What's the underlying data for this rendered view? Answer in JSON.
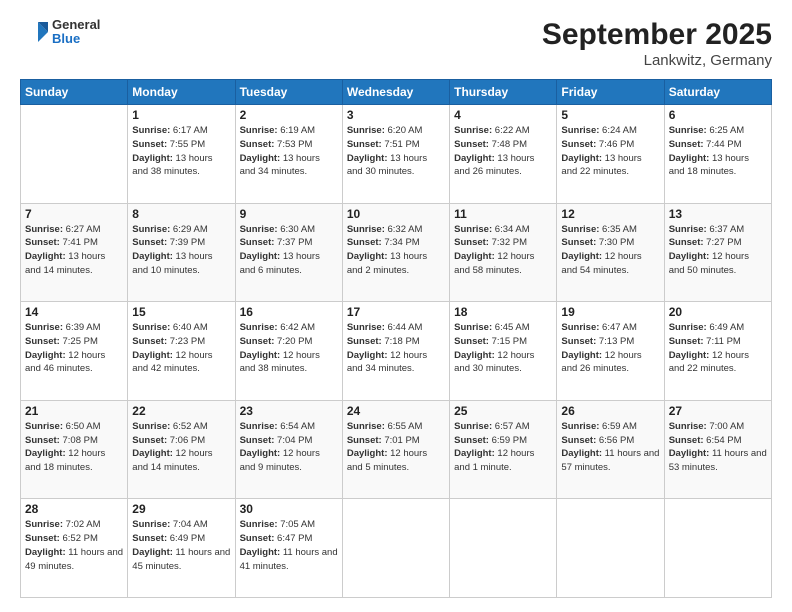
{
  "header": {
    "logo_general": "General",
    "logo_blue": "Blue",
    "title": "September 2025",
    "subtitle": "Lankwitz, Germany"
  },
  "calendar": {
    "days_of_week": [
      "Sunday",
      "Monday",
      "Tuesday",
      "Wednesday",
      "Thursday",
      "Friday",
      "Saturday"
    ],
    "weeks": [
      [
        {
          "day": "",
          "info": ""
        },
        {
          "day": "1",
          "info": "Sunrise: 6:17 AM\nSunset: 7:55 PM\nDaylight: 13 hours and 38 minutes."
        },
        {
          "day": "2",
          "info": "Sunrise: 6:19 AM\nSunset: 7:53 PM\nDaylight: 13 hours and 34 minutes."
        },
        {
          "day": "3",
          "info": "Sunrise: 6:20 AM\nSunset: 7:51 PM\nDaylight: 13 hours and 30 minutes."
        },
        {
          "day": "4",
          "info": "Sunrise: 6:22 AM\nSunset: 7:48 PM\nDaylight: 13 hours and 26 minutes."
        },
        {
          "day": "5",
          "info": "Sunrise: 6:24 AM\nSunset: 7:46 PM\nDaylight: 13 hours and 22 minutes."
        },
        {
          "day": "6",
          "info": "Sunrise: 6:25 AM\nSunset: 7:44 PM\nDaylight: 13 hours and 18 minutes."
        }
      ],
      [
        {
          "day": "7",
          "info": "Sunrise: 6:27 AM\nSunset: 7:41 PM\nDaylight: 13 hours and 14 minutes."
        },
        {
          "day": "8",
          "info": "Sunrise: 6:29 AM\nSunset: 7:39 PM\nDaylight: 13 hours and 10 minutes."
        },
        {
          "day": "9",
          "info": "Sunrise: 6:30 AM\nSunset: 7:37 PM\nDaylight: 13 hours and 6 minutes."
        },
        {
          "day": "10",
          "info": "Sunrise: 6:32 AM\nSunset: 7:34 PM\nDaylight: 13 hours and 2 minutes."
        },
        {
          "day": "11",
          "info": "Sunrise: 6:34 AM\nSunset: 7:32 PM\nDaylight: 12 hours and 58 minutes."
        },
        {
          "day": "12",
          "info": "Sunrise: 6:35 AM\nSunset: 7:30 PM\nDaylight: 12 hours and 54 minutes."
        },
        {
          "day": "13",
          "info": "Sunrise: 6:37 AM\nSunset: 7:27 PM\nDaylight: 12 hours and 50 minutes."
        }
      ],
      [
        {
          "day": "14",
          "info": "Sunrise: 6:39 AM\nSunset: 7:25 PM\nDaylight: 12 hours and 46 minutes."
        },
        {
          "day": "15",
          "info": "Sunrise: 6:40 AM\nSunset: 7:23 PM\nDaylight: 12 hours and 42 minutes."
        },
        {
          "day": "16",
          "info": "Sunrise: 6:42 AM\nSunset: 7:20 PM\nDaylight: 12 hours and 38 minutes."
        },
        {
          "day": "17",
          "info": "Sunrise: 6:44 AM\nSunset: 7:18 PM\nDaylight: 12 hours and 34 minutes."
        },
        {
          "day": "18",
          "info": "Sunrise: 6:45 AM\nSunset: 7:15 PM\nDaylight: 12 hours and 30 minutes."
        },
        {
          "day": "19",
          "info": "Sunrise: 6:47 AM\nSunset: 7:13 PM\nDaylight: 12 hours and 26 minutes."
        },
        {
          "day": "20",
          "info": "Sunrise: 6:49 AM\nSunset: 7:11 PM\nDaylight: 12 hours and 22 minutes."
        }
      ],
      [
        {
          "day": "21",
          "info": "Sunrise: 6:50 AM\nSunset: 7:08 PM\nDaylight: 12 hours and 18 minutes."
        },
        {
          "day": "22",
          "info": "Sunrise: 6:52 AM\nSunset: 7:06 PM\nDaylight: 12 hours and 14 minutes."
        },
        {
          "day": "23",
          "info": "Sunrise: 6:54 AM\nSunset: 7:04 PM\nDaylight: 12 hours and 9 minutes."
        },
        {
          "day": "24",
          "info": "Sunrise: 6:55 AM\nSunset: 7:01 PM\nDaylight: 12 hours and 5 minutes."
        },
        {
          "day": "25",
          "info": "Sunrise: 6:57 AM\nSunset: 6:59 PM\nDaylight: 12 hours and 1 minute."
        },
        {
          "day": "26",
          "info": "Sunrise: 6:59 AM\nSunset: 6:56 PM\nDaylight: 11 hours and 57 minutes."
        },
        {
          "day": "27",
          "info": "Sunrise: 7:00 AM\nSunset: 6:54 PM\nDaylight: 11 hours and 53 minutes."
        }
      ],
      [
        {
          "day": "28",
          "info": "Sunrise: 7:02 AM\nSunset: 6:52 PM\nDaylight: 11 hours and 49 minutes."
        },
        {
          "day": "29",
          "info": "Sunrise: 7:04 AM\nSunset: 6:49 PM\nDaylight: 11 hours and 45 minutes."
        },
        {
          "day": "30",
          "info": "Sunrise: 7:05 AM\nSunset: 6:47 PM\nDaylight: 11 hours and 41 minutes."
        },
        {
          "day": "",
          "info": ""
        },
        {
          "day": "",
          "info": ""
        },
        {
          "day": "",
          "info": ""
        },
        {
          "day": "",
          "info": ""
        }
      ]
    ]
  }
}
